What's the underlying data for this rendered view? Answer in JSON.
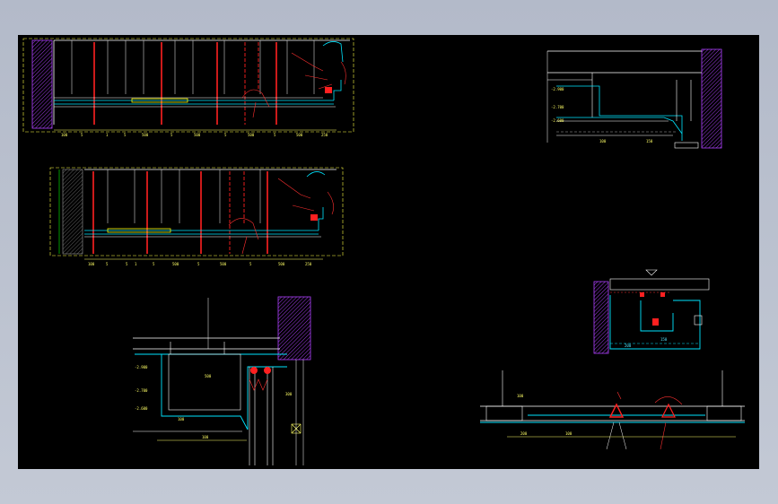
{
  "drawing": {
    "background": "#000000",
    "colors": {
      "wall_hatch": "#b040ff",
      "structure": "#ffffff",
      "finish": "#00e5ff",
      "hanger_rod": "#ff2020",
      "light_fixture": "#ffff00",
      "dimension": "#ffff66",
      "section_line": "#ff3030"
    },
    "details": [
      {
        "id": "section-a",
        "dimensions": [
          "100",
          "5",
          "1",
          "5",
          "500",
          "5",
          "500",
          "5",
          "500",
          "5",
          "500",
          "250"
        ]
      },
      {
        "id": "section-b",
        "dimensions": [
          "100",
          "5",
          "5",
          "1",
          "5",
          "500",
          "5",
          "500",
          "5",
          "500",
          "250"
        ]
      },
      {
        "id": "detail-c",
        "labels": [
          "-2.900",
          "-2.700",
          "-2.600",
          "100",
          "150"
        ]
      },
      {
        "id": "detail-d",
        "labels": [
          "150",
          "200"
        ]
      },
      {
        "id": "detail-e",
        "labels": [
          "-2.900",
          "-2.700",
          "-2.600",
          "500",
          "300",
          "100",
          "100"
        ]
      },
      {
        "id": "detail-f",
        "labels": [
          "100",
          "200",
          "100"
        ]
      }
    ]
  }
}
